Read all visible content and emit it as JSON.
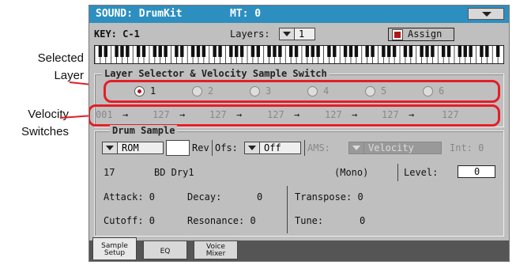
{
  "annotations": {
    "selected_layer": [
      "Selected",
      "Layer"
    ],
    "velocity_switches": [
      "Velocity",
      "Switches"
    ]
  },
  "header": {
    "title": "SOUND: DrumKit",
    "mt": "MT: 0"
  },
  "key_row": {
    "key": "KEY: C-1",
    "layers_label": "Layers:",
    "layers_value": "1",
    "assign_label": "Assign",
    "assign_checked": true
  },
  "layer_selector": {
    "title": "Layer Selector & Velocity Sample Switch",
    "layers": [
      "1",
      "2",
      "3",
      "4",
      "5",
      "6"
    ],
    "selected": 0,
    "velocity": [
      "001",
      "127",
      "127",
      "127",
      "127",
      "127",
      "127"
    ],
    "arrow": "→"
  },
  "drum_sample": {
    "title": "Drum Sample",
    "bank": "ROM",
    "rev_label": "Rev",
    "ofs_label": "Ofs:",
    "ofs_value": "Off",
    "ams_label": "AMS:",
    "ams_value": "Velocity",
    "int_label": "Int: 0",
    "sample_number": "17",
    "sample_name": "BD Dry1",
    "mode": "(Mono)",
    "level_label": "Level:",
    "level_value": "0",
    "attack": "Attack: 0",
    "decay_label": "Decay:",
    "decay_value": "0",
    "transpose": "Transpose: 0",
    "cutoff": "Cutoff: 0",
    "resonance": "Resonance: 0",
    "tune_label": "Tune:",
    "tune_value": "0"
  },
  "tabs": [
    {
      "line1": "Sample",
      "line2": "Setup"
    },
    {
      "line1": "EQ",
      "line2": ""
    },
    {
      "line1": "Voice",
      "line2": "Mixer"
    }
  ],
  "colors": {
    "title_bar": "#2d8fbf",
    "annotation_red": "#e41e26",
    "screen_bg": "#bfbfbf"
  }
}
